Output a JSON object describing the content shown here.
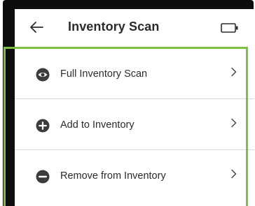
{
  "app_bar": {
    "title": "Inventory Scan",
    "back_icon": "arrow-left-icon",
    "battery_icon": "battery-icon"
  },
  "menu": {
    "items": [
      {
        "label": "Full Inventory Scan",
        "icon": "eye-icon",
        "chevron": "chevron-right-icon"
      },
      {
        "label": "Add to Inventory",
        "icon": "plus-circle-icon",
        "chevron": "chevron-right-icon"
      },
      {
        "label": "Remove from Inventory",
        "icon": "minus-circle-icon",
        "chevron": "chevron-right-icon"
      }
    ]
  },
  "colors": {
    "highlight": "#7ac142",
    "text": "#2b2b2b",
    "icon": "#3c3c3c",
    "divider": "#d9d9d9",
    "device_bezel": "#0d0d0d"
  }
}
